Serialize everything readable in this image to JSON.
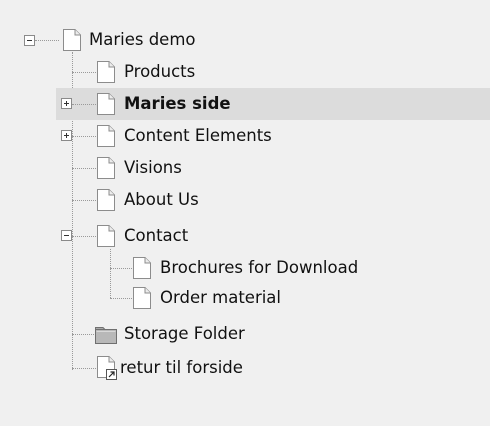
{
  "tree": {
    "root": {
      "label": "Maries demo",
      "expanded": true,
      "icon": "page-icon"
    },
    "children": [
      {
        "label": "Products",
        "icon": "page-icon"
      },
      {
        "label": "Maries side",
        "icon": "page-icon",
        "expandable": true,
        "expanded": false,
        "selected": true
      },
      {
        "label": "Content Elements",
        "icon": "page-icon",
        "expandable": true,
        "expanded": false
      },
      {
        "label": "Visions",
        "icon": "page-icon"
      },
      {
        "label": "About Us",
        "icon": "page-icon"
      },
      {
        "label": "Contact",
        "icon": "page-icon",
        "expandable": true,
        "expanded": true,
        "children": [
          {
            "label": "Brochures for Download",
            "icon": "page-icon"
          },
          {
            "label": "Order material",
            "icon": "page-icon"
          }
        ]
      },
      {
        "label": "Storage Folder",
        "icon": "folder-icon"
      },
      {
        "label": "retur til forside",
        "icon": "shortcut-page-icon"
      }
    ]
  }
}
